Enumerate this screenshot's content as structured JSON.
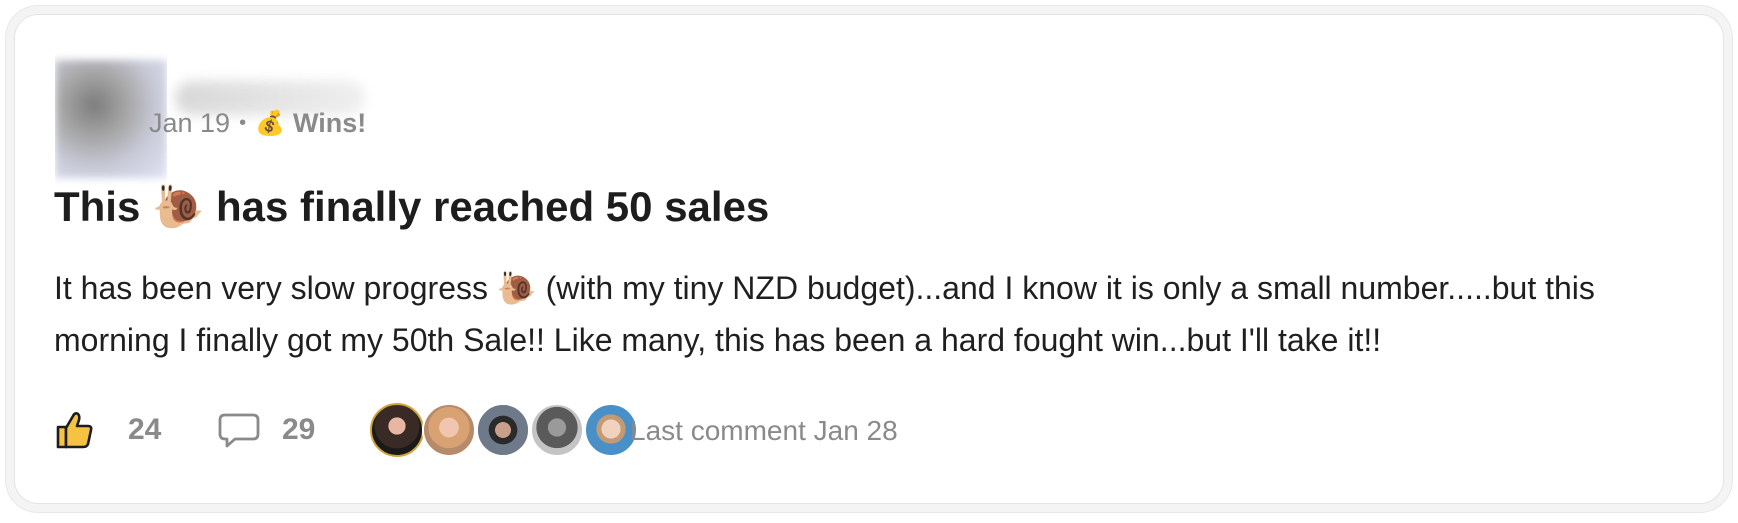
{
  "post": {
    "date": "Jan 19",
    "separator": "•",
    "category_emoji": "💰",
    "category": "Wins!",
    "title": "This 🐌 has finally reached 50 sales",
    "body": "It has been very slow progress 🐌 (with my tiny NZD budget)...and I know it is only a small number.....but this morning I finally got my 50th Sale!! Like many, this has been a hard fought win...but I'll take it!!"
  },
  "footer": {
    "like_icon": "thumbs-up-icon",
    "like_count": "24",
    "comment_icon": "comment-bubble-icon",
    "comment_count": "29",
    "last_comment": "Last comment Jan 28",
    "commenter_avatars": 5
  },
  "colors": {
    "title": "#1d1d1d",
    "muted": "#8a8a8a",
    "like_icon_fill": "#f5c242"
  }
}
